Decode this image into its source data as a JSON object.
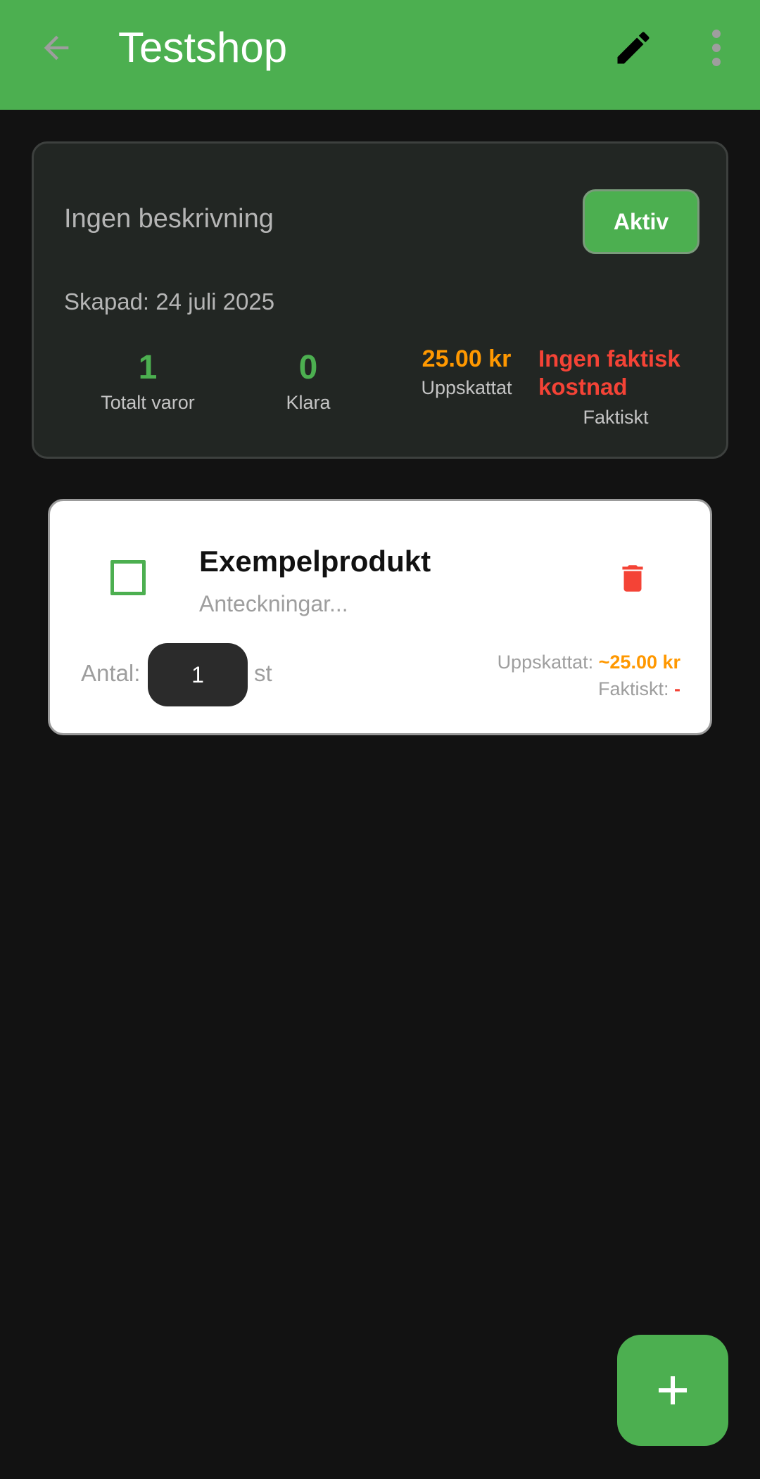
{
  "appbar": {
    "title": "Testshop",
    "back_icon": "arrow-back-icon",
    "edit_icon": "pencil-icon",
    "more_icon": "more-vert-icon",
    "color": "#4caf50"
  },
  "summary": {
    "description": "Ingen beskrivning",
    "status_label": "Aktiv",
    "created": "Skapad: 24 juli 2025",
    "stats": {
      "total_value": "1",
      "total_label": "Totalt varor",
      "done_value": "0",
      "done_label": "Klara",
      "estimated_value": "25.00 kr",
      "estimated_label": "Uppskattat",
      "actual_value": "Ingen faktisk kostnad",
      "actual_label": "Faktiskt"
    }
  },
  "item": {
    "name": "Exempelprodukt",
    "notes_placeholder": "Anteckningar...",
    "checked": false,
    "delete_icon": "trash-icon",
    "quantity_label": "Antal:",
    "quantity_value": "1",
    "quantity_unit": "st",
    "estimated_label": "Uppskattat: ",
    "estimated_value": "~25.00 kr",
    "actual_label": "Faktiskt: ",
    "actual_value": "-"
  },
  "fab": {
    "icon": "plus-icon"
  },
  "colors": {
    "accent": "#4caf50",
    "estimate": "#ff9800",
    "error": "#f44336",
    "background": "#121212"
  }
}
